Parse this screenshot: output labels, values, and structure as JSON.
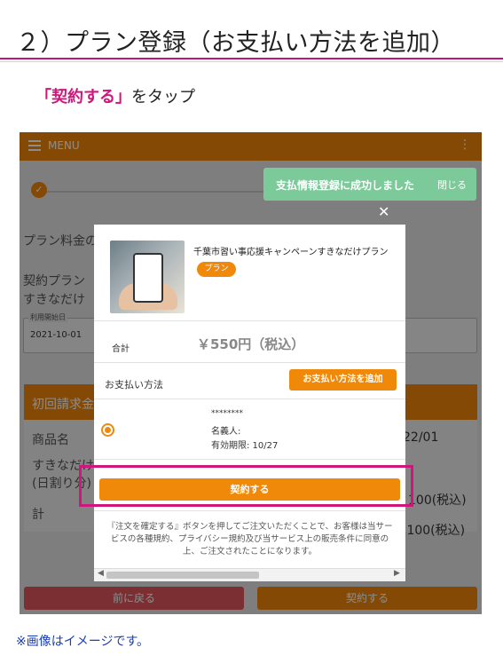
{
  "header": {
    "title": "２）プラン登録（お支払い方法を追加）",
    "instruction_highlight": "「契約する」",
    "instruction_rest": "をタップ"
  },
  "app": {
    "menu_label": "MENU",
    "kebab": "⋮",
    "step_check": "✓",
    "bg_plan_fee": "プラン料金の",
    "bg_contract_plan": "契約プラン",
    "bg_plan_short": "すきなだけ",
    "bg_start_label": "利用開始日",
    "bg_start_value": "2021-10-01",
    "bg_first_bill": "初回請求金",
    "bg_col_product": "商品名",
    "bg_date_tail": "22/01",
    "bg_row1a": "すきなだけ",
    "bg_row1b": "(日割り分)",
    "bg_row1_price": "100(税込)",
    "bg_total": "計",
    "bg_total_price": ",100(税込)",
    "bg_back_button": "前に戻る",
    "bg_contract_button": "契約する"
  },
  "toast": {
    "message": "支払情報登録に成功しました",
    "close_label": "閉じる"
  },
  "modal": {
    "close_symbol": "✕",
    "product_name": "千葉市習い事応援キャンペーンすきなだけプラン",
    "badge": "プラン",
    "total_label": "合計",
    "total_value": "￥550円（税込）",
    "payment_method_label": "お支払い方法",
    "add_payment_button": "お支払い方法を追加",
    "card_mask": "********",
    "holder_label": "名義人:",
    "expiry_label": "有効期限: 10/27",
    "contract_button": "契約する",
    "terms_text": "『注文を確定する』ボタンを押してご注文いただくことで、お客様は当サービスの各種規約、プライバシー規約及び当サービス上の販売条件に同意の上、ご注文されたことになります。",
    "scroll_left": "◀",
    "scroll_right": "▶"
  },
  "footer_note": "※画像はイメージです。",
  "colors": {
    "accent": "#f0880a",
    "highlight": "#d0157d",
    "toast": "#7cc99a",
    "note": "#1a3fb5"
  }
}
